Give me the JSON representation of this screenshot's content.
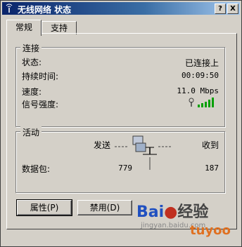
{
  "window": {
    "title": "无线网络 状态",
    "help_button": "?",
    "close_button": "X"
  },
  "tabs": [
    {
      "label": "常规",
      "active": true
    },
    {
      "label": "支持",
      "active": false
    }
  ],
  "connection": {
    "group_title": "连接",
    "status_label": "状态:",
    "status_value": "已连接上",
    "duration_label": "持续时间:",
    "duration_value": "00:09:50",
    "speed_label": "速度:",
    "speed_value": "11.0 Mbps",
    "signal_label": "信号强度:",
    "signal_bars": 5,
    "signal_color": "#00a000"
  },
  "activity": {
    "group_title": "活动",
    "sent_label": "发送",
    "received_label": "收到",
    "packets_label": "数据包:",
    "packets_sent": "779",
    "packets_received": "187"
  },
  "buttons": {
    "properties": "属性(P)",
    "disable": "禁用(D)"
  },
  "watermark": {
    "baidu": "Bai",
    "baidu2": "经验",
    "url": "jingyan.baidu.com",
    "tuyoo": "tuyoo",
    "tuyoo_color": "#e07020",
    "baidu_color": "#2050c0"
  }
}
